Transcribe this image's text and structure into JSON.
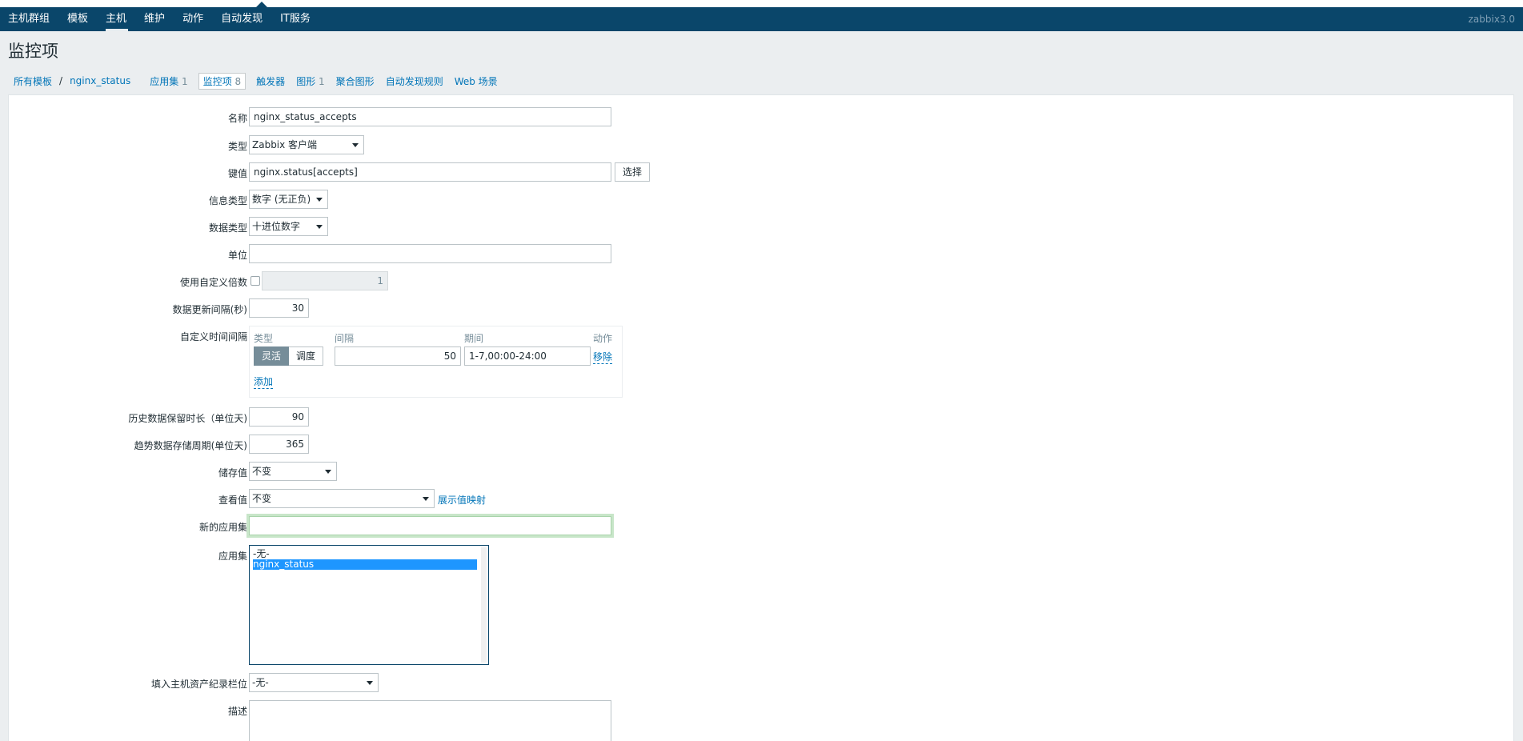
{
  "topnav": {
    "items": [
      "主机群组",
      "模板",
      "主机",
      "维护",
      "动作",
      "自动发现",
      "IT服务"
    ],
    "active_index": 2,
    "brand": "zabbix3.0"
  },
  "page_title": "监控项",
  "breadcrumbs": {
    "all_templates": "所有模板",
    "separator": "/",
    "template": "nginx_status",
    "applications": "应用集",
    "applications_count": "1",
    "items": "监控项",
    "items_count": "8",
    "triggers": "触发器",
    "graphs": "图形",
    "graphs_count": "1",
    "screens": "聚合图形",
    "discovery": "自动发现规则",
    "web": "Web 场景"
  },
  "form": {
    "name": {
      "label": "名称",
      "value": "nginx_status_accepts"
    },
    "type": {
      "label": "类型",
      "value": "Zabbix 客户端"
    },
    "key": {
      "label": "键值",
      "value": "nginx.status[accepts]",
      "select_button": "选择"
    },
    "value_type": {
      "label": "信息类型",
      "value": "数字 (无正负)"
    },
    "data_type": {
      "label": "数据类型",
      "value": "十进位数字"
    },
    "units": {
      "label": "单位",
      "value": ""
    },
    "multiplier": {
      "label": "使用自定义倍数",
      "checked": false,
      "value": "1"
    },
    "delay": {
      "label": "数据更新间隔(秒)",
      "value": "30"
    },
    "flex_intervals": {
      "label": "自定义时间间隔",
      "headers": {
        "type": "类型",
        "interval": "间隔",
        "period": "期间",
        "action": "动作"
      },
      "row": {
        "type_flexible": "灵活",
        "type_scheduling": "调度",
        "interval": "50",
        "period": "1-7,00:00-24:00",
        "remove": "移除"
      },
      "add": "添加"
    },
    "history": {
      "label": "历史数据保留时长（单位天)",
      "value": "90"
    },
    "trends": {
      "label": "趋势数据存储周期(单位天)",
      "value": "365"
    },
    "store_value": {
      "label": "储存值",
      "value": "不变"
    },
    "show_value": {
      "label": "查看值",
      "value": "不变",
      "link": "展示值映射"
    },
    "new_application": {
      "label": "新的应用集",
      "value": ""
    },
    "applications": {
      "label": "应用集",
      "options": [
        "-无-",
        "nginx_status"
      ],
      "selected_index": 1
    },
    "inventory": {
      "label": "填入主机资产纪录栏位",
      "value": "-无-"
    },
    "description": {
      "label": "描述",
      "value": ""
    }
  }
}
